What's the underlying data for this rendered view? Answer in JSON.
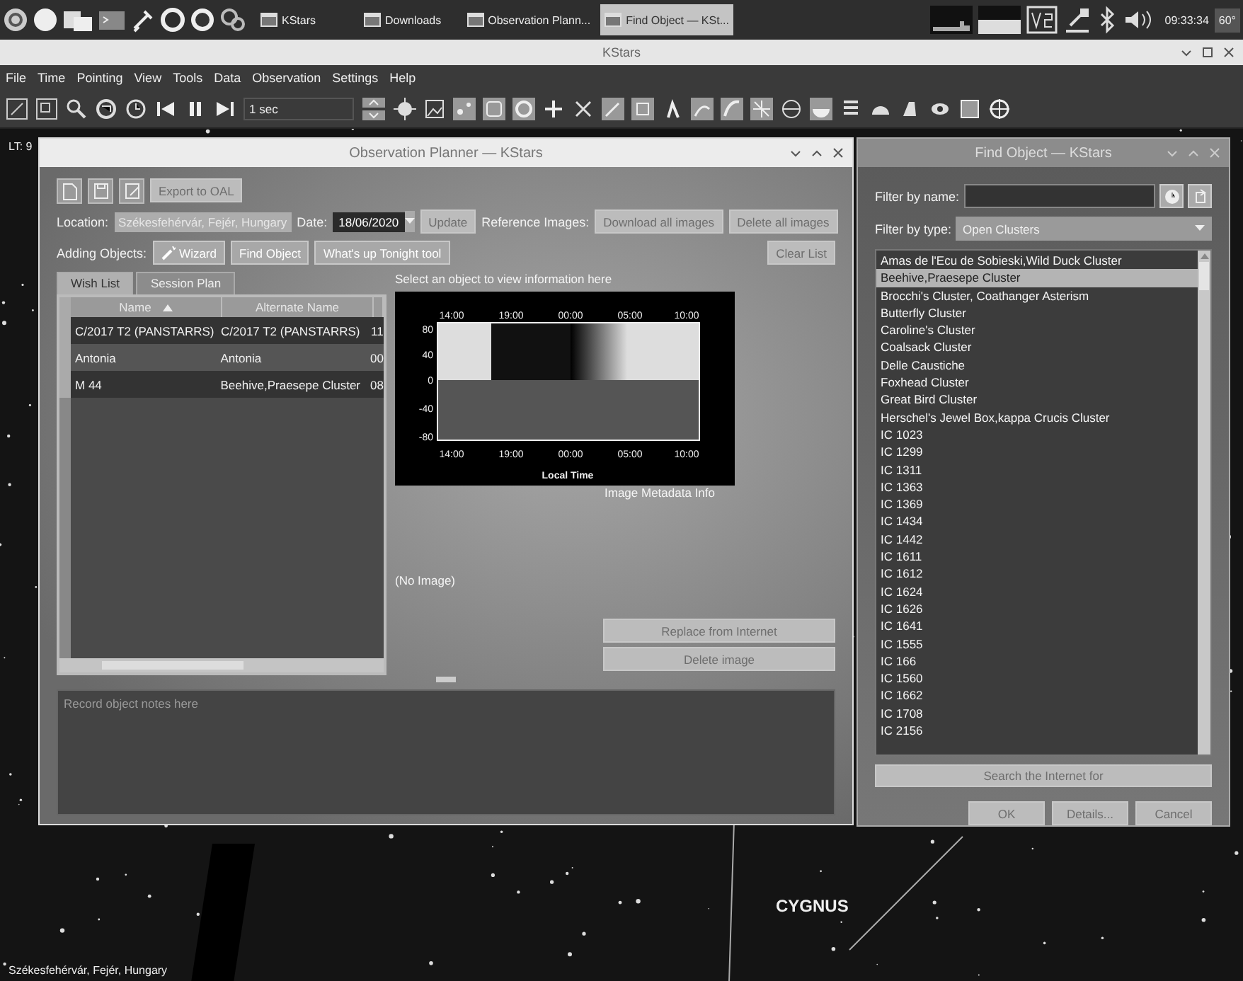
{
  "taskbar": {
    "tasks": [
      {
        "label": "KStars",
        "selected": false
      },
      {
        "label": "Downloads",
        "selected": false
      },
      {
        "label": "Observation Plann...",
        "selected": false
      },
      {
        "label": "Find Object — KSt...",
        "selected": true
      }
    ],
    "clock": "09:33:34",
    "temperature": "60°"
  },
  "main_window": {
    "title": "KStars",
    "menu": [
      "File",
      "Time",
      "Pointing",
      "View",
      "Tools",
      "Data",
      "Observation",
      "Settings",
      "Help"
    ],
    "toolbar": {
      "time_step": "1 sec"
    },
    "sky": {
      "info_label": "LT: 9",
      "constellation": "CYGNUS",
      "location": "Székesfehérvár, Fejér, Hungary"
    }
  },
  "planner": {
    "title": "Observation Planner — KStars",
    "export_button": {
      "label": "Export to OAL",
      "disabled": true
    },
    "location_label": "Location:",
    "location": "Székesfehérvár, Fejér, Hungary",
    "date_label": "Date:",
    "date": "18/06/2020",
    "update_button": {
      "label": "Update",
      "disabled": true
    },
    "reference_label": "Reference Images:",
    "reference_buttons": [
      {
        "label": "Download all images",
        "disabled": true
      },
      {
        "label": "Delete all images",
        "disabled": true
      }
    ],
    "adding_label": "Adding Objects:",
    "adding_buttons": [
      {
        "label": "Wizard",
        "kind": "wizard",
        "disabled": false
      },
      {
        "label": "Find Object",
        "kind": "plain",
        "disabled": false
      },
      {
        "label": "What's up Tonight tool",
        "kind": "plain",
        "disabled": false
      }
    ],
    "clear_button": {
      "label": "Clear List",
      "disabled": true
    },
    "tabs": [
      {
        "label": "Wish List",
        "selected": true
      },
      {
        "label": "Session Plan",
        "selected": false
      }
    ],
    "table": {
      "columns": [
        {
          "label": "Name",
          "sorted": true
        },
        {
          "label": "Alternate Name",
          "sorted": false
        }
      ],
      "rows": [
        {
          "cells": [
            "C/2017 T2 (PANSTARRS)",
            "C/2017 T2 (PANSTARRS)",
            "11"
          ]
        },
        {
          "cells": [
            "Antonia",
            "Antonia",
            "00"
          ]
        },
        {
          "cells": [
            "M 44",
            "Beehive,Praesepe Cluster",
            "08"
          ]
        }
      ]
    },
    "info_hint": "Select an object to view information here",
    "altitude_plot": {
      "top_ticks": [
        "14:00",
        "19:00",
        "00:00",
        "05:00",
        "10:00"
      ],
      "y_ticks": [
        "80",
        "40",
        "0",
        "-40",
        "-80"
      ],
      "bottom_ticks": [
        "14:00",
        "19:00",
        "00:00",
        "05:00",
        "10:00"
      ],
      "xlabel": "Local Time"
    },
    "metadata_label": "Image Metadata Info",
    "no_image": "(No Image)",
    "image_buttons": [
      {
        "label": "Replace from Internet",
        "disabled": true
      },
      {
        "label": "Delete image",
        "disabled": true
      }
    ],
    "notes_placeholder": "Record object notes here"
  },
  "find_object": {
    "title": "Find Object — KStars",
    "name_label": "Filter by name:",
    "type_label": "Filter by type:",
    "type_value": "Open Clusters",
    "items": [
      {
        "label": "Amas de l'Ecu de Sobieski,Wild Duck Cluster",
        "selected": false
      },
      {
        "label": "Beehive,Praesepe Cluster",
        "selected": true
      },
      {
        "label": "Brocchi's Cluster, Coathanger Asterism",
        "selected": false
      },
      {
        "label": "Butterfly Cluster",
        "selected": false
      },
      {
        "label": "Caroline's Cluster",
        "selected": false
      },
      {
        "label": "Coalsack Cluster",
        "selected": false
      },
      {
        "label": "Delle Caustiche",
        "selected": false
      },
      {
        "label": "Foxhead Cluster",
        "selected": false
      },
      {
        "label": "Great Bird Cluster",
        "selected": false
      },
      {
        "label": "Herschel's Jewel Box,kappa Crucis Cluster",
        "selected": false
      },
      {
        "label": "IC 1023",
        "selected": false
      },
      {
        "label": "IC 1299",
        "selected": false
      },
      {
        "label": "IC 1311",
        "selected": false
      },
      {
        "label": "IC 1363",
        "selected": false
      },
      {
        "label": "IC 1369",
        "selected": false
      },
      {
        "label": "IC 1434",
        "selected": false
      },
      {
        "label": "IC 1442",
        "selected": false
      },
      {
        "label": "IC 1611",
        "selected": false
      },
      {
        "label": "IC 1612",
        "selected": false
      },
      {
        "label": "IC 1624",
        "selected": false
      },
      {
        "label": "IC 1626",
        "selected": false
      },
      {
        "label": "IC 1641",
        "selected": false
      },
      {
        "label": "IC 1555",
        "selected": false
      },
      {
        "label": "IC 166",
        "selected": false
      },
      {
        "label": "IC 1560",
        "selected": false
      },
      {
        "label": "IC 1662",
        "selected": false
      },
      {
        "label": "IC 1708",
        "selected": false
      },
      {
        "label": "IC 2156",
        "selected": false
      }
    ],
    "search_button": {
      "label": "Search the Internet for",
      "disabled": true
    },
    "buttons": [
      {
        "label": "OK",
        "disabled": true
      },
      {
        "label": "Details...",
        "disabled": true
      },
      {
        "label": "Cancel",
        "disabled": true
      }
    ]
  }
}
